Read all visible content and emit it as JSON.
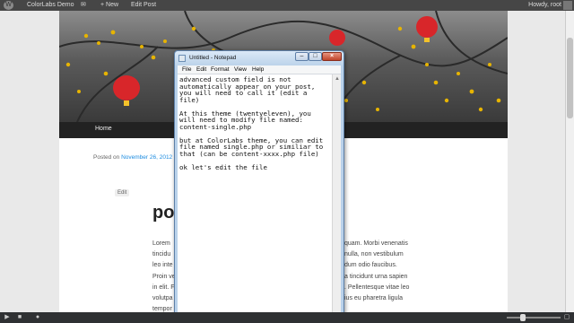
{
  "admin_bar": {
    "site_name": "ColorLabs Demo",
    "new_label": "+ New",
    "edit_post_label": "Edit Post",
    "howdy": "Howdy, root"
  },
  "site": {
    "nav_home": "Home",
    "posted_on": "Posted on ",
    "post_date": "November 26, 2012",
    "edit_link": "Edit",
    "post_title": "pos",
    "body_lines": [
      "Lorem",
      "tincidu",
      "leo inte",
      "Proin ve",
      "in elit. F",
      "volutpa",
      "tempor"
    ],
    "body_right_lines": [
      "quam. Morbi venenatis",
      "nulla, non vestibulum",
      "dum odio faucibus.",
      "a tincidunt urna sapien",
      ". Pellentesque vitae leo",
      "ius eu pharetra ligula",
      ""
    ]
  },
  "notepad": {
    "title": "Untitled - Notepad",
    "menu": [
      "File",
      "Edit",
      "Format",
      "View",
      "Help"
    ],
    "text_lines": [
      "advanced custom field is not",
      "automatically appear on your post,",
      "you will need to call it (edit a",
      "file)",
      "",
      "At this theme (twentyeleven), you",
      "will need to modify file named:",
      "content-single.php",
      "",
      "but at ColorLabs theme, you can edit",
      "file named single.php or similiar to",
      "that (can be content-xxxx.php file)",
      "",
      "ok let's edit the file"
    ]
  },
  "colors": {
    "admin_bar_bg": "#464646",
    "link_blue": "#1b8be0",
    "lantern_red": "#d8262a",
    "blossom_yellow": "#e7b400"
  }
}
